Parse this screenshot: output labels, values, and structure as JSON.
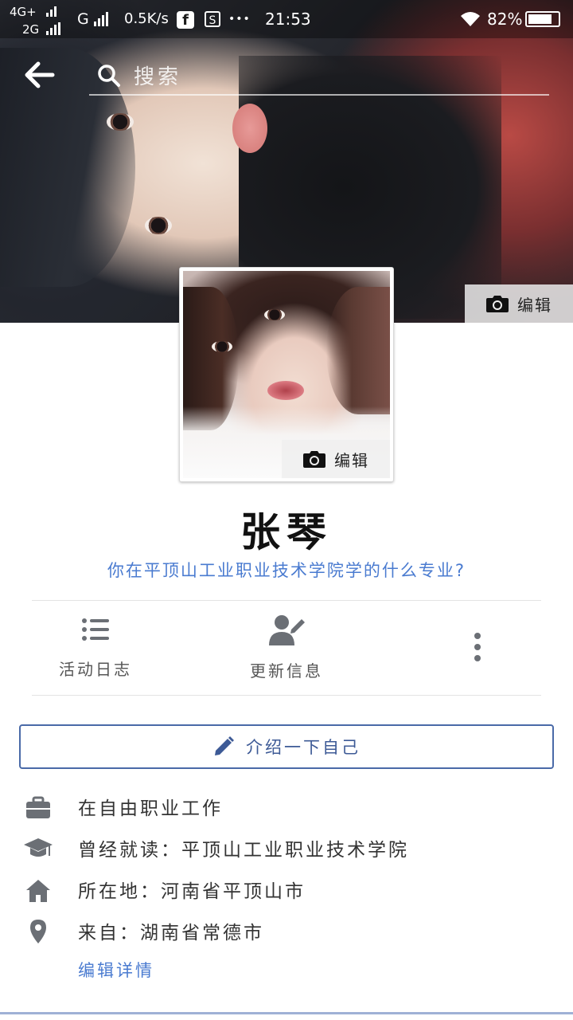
{
  "status_bar": {
    "network1": "4G+",
    "network2": "2G",
    "carrier_g": "G",
    "speed": "0.5K/s",
    "time": "21:53",
    "battery": "82%",
    "battery_level": 0.82,
    "dots": "•••"
  },
  "header": {
    "search_placeholder": "搜索"
  },
  "cover": {
    "edit_label": "编辑"
  },
  "avatar": {
    "edit_label": "编辑"
  },
  "profile": {
    "name": "张琴",
    "prompt": "你在平顶山工业职业技术学院学的什么专业?"
  },
  "actions": [
    {
      "label": "活动日志",
      "icon": "list-icon"
    },
    {
      "label": "更新信息",
      "icon": "edit-person-icon"
    },
    {
      "label": "",
      "icon": "more-vertical-icon"
    }
  ],
  "intro_button": {
    "label": "介绍一下自己",
    "icon": "pencil-icon"
  },
  "info": [
    {
      "text": "在自由职业工作",
      "icon": "briefcase-icon"
    },
    {
      "text": "曾经就读：平顶山工业职业技术学院",
      "icon": "graduation-cap-icon"
    },
    {
      "text": "所在地：河南省平顶山市",
      "icon": "home-icon"
    },
    {
      "text": "来自：湖南省常德市",
      "icon": "location-pin-icon"
    }
  ],
  "edit_details": "编辑详情",
  "colors": {
    "accent": "#4a7bd0",
    "button_border": "#4a6aa8",
    "icon_gray": "#6b6f75"
  }
}
